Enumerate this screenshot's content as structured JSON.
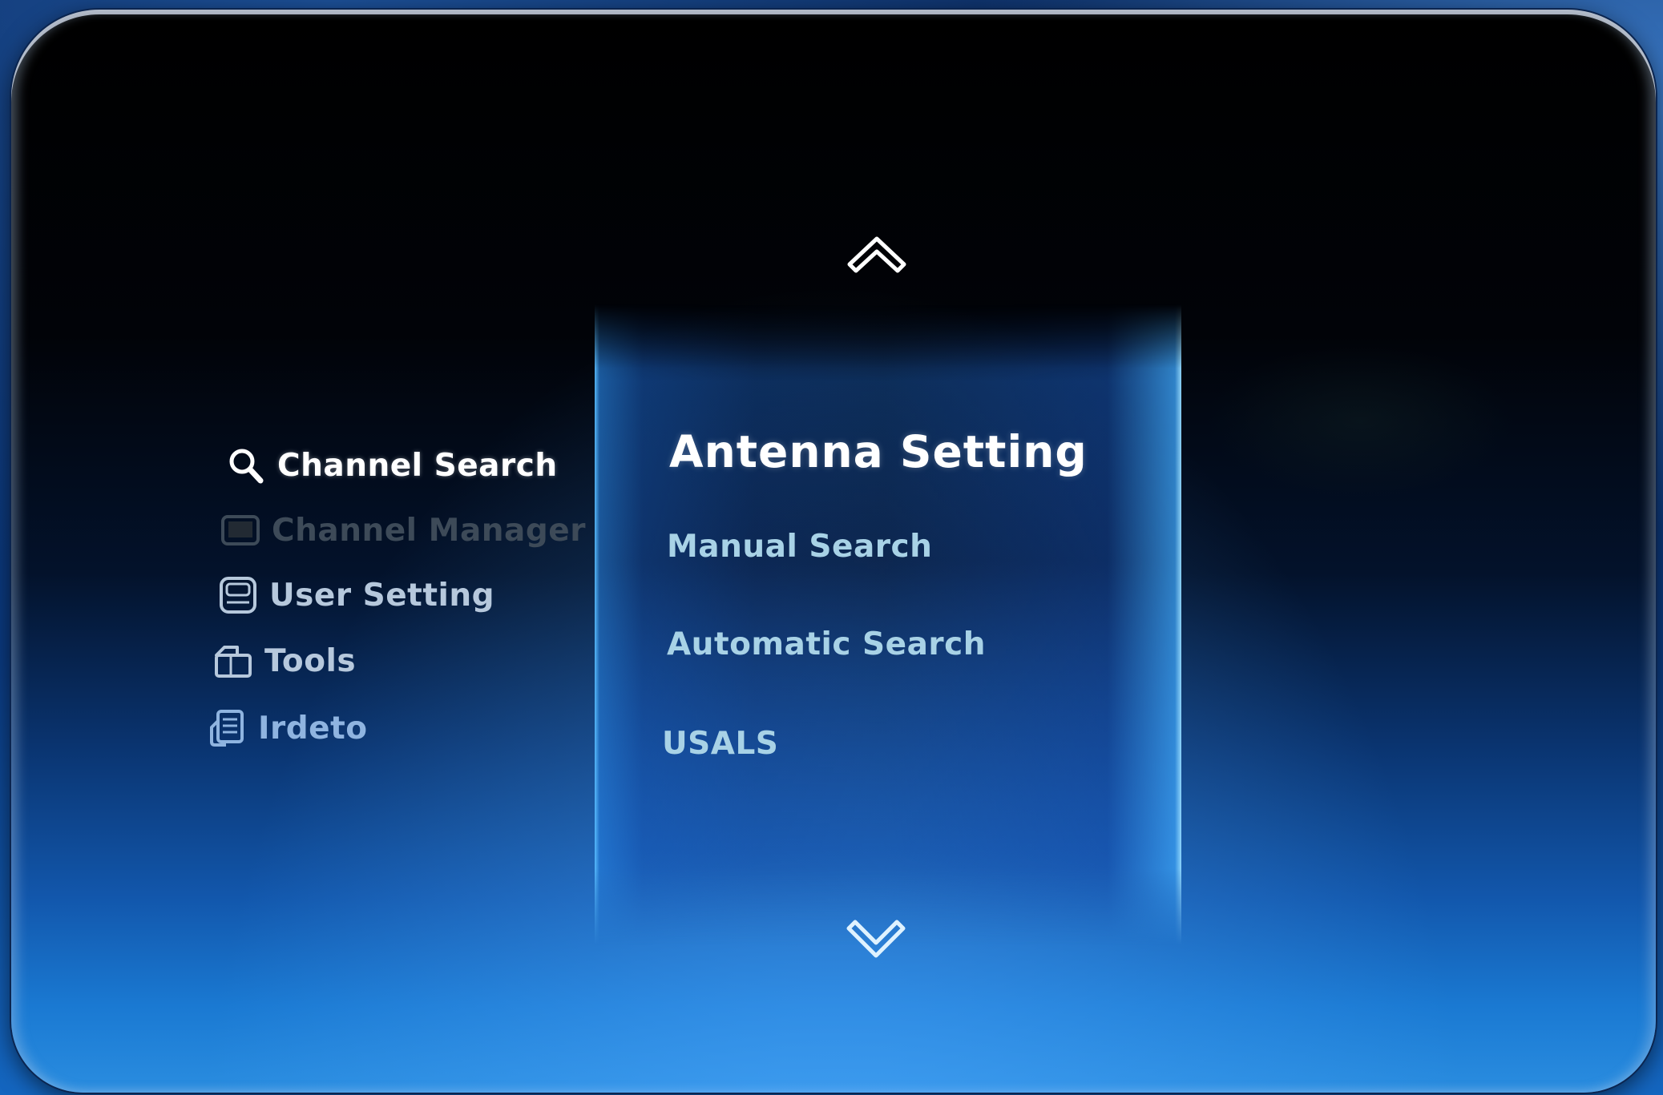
{
  "side_menu": {
    "items": [
      {
        "label": "Channel Search",
        "icon": "search-icon",
        "state": "selected"
      },
      {
        "label": "Channel Manager",
        "icon": "tv-icon",
        "state": "disabled"
      },
      {
        "label": "User Setting",
        "icon": "user-setting-icon",
        "state": "normal"
      },
      {
        "label": "Tools",
        "icon": "toolbox-icon",
        "state": "normal"
      },
      {
        "label": "Irdeto",
        "icon": "irdeto-icon",
        "state": "normal"
      }
    ]
  },
  "submenu": {
    "title": "Antenna Setting",
    "items": [
      {
        "label": "Manual Search"
      },
      {
        "label": "Automatic Search"
      },
      {
        "label": "USALS"
      }
    ],
    "scroll_up_icon": "chevron-up-icon",
    "scroll_down_icon": "chevron-down-icon"
  },
  "colors": {
    "selected_text": "#ffffff",
    "disabled_text": "#3d4a58",
    "submenu_text": "#a8d2e6",
    "accent_glow": "#5abeff"
  }
}
